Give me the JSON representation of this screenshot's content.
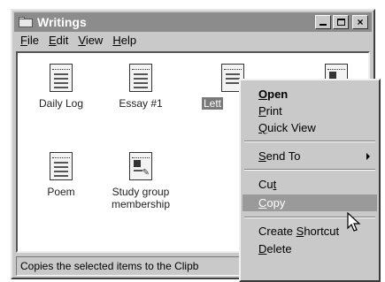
{
  "window": {
    "title": "Writings",
    "buttons": {
      "minimize": "_",
      "maximize": "□",
      "close": "×"
    }
  },
  "menubar": {
    "items": [
      {
        "underline": "F",
        "rest": "ile"
      },
      {
        "underline": "E",
        "rest": "dit"
      },
      {
        "underline": "V",
        "rest": "iew"
      },
      {
        "underline": "H",
        "rest": "elp"
      }
    ]
  },
  "files": [
    {
      "label": "Daily Log",
      "icon": "document-icon"
    },
    {
      "label": "Essay #1",
      "icon": "document-icon"
    },
    {
      "label": "Lett",
      "icon": "document-icon",
      "selected": true
    },
    {
      "label": "",
      "icon": "picture-document-icon"
    },
    {
      "label": "Poem",
      "icon": "document-icon"
    },
    {
      "label": "Study group membership",
      "icon": "picture-document-icon"
    }
  ],
  "status": {
    "text": "Copies the selected items to the Clipb"
  },
  "context_menu": {
    "items": [
      {
        "pre": "",
        "ul": "O",
        "post": "pen"
      },
      {
        "pre": "",
        "ul": "P",
        "post": "rint"
      },
      {
        "pre": "",
        "ul": "Q",
        "post": "uick View"
      },
      {
        "pre": "",
        "ul": "S",
        "post": "end To"
      },
      {
        "pre": "Cu",
        "ul": "t",
        "post": ""
      },
      {
        "pre": "",
        "ul": "C",
        "post": "opy"
      },
      {
        "pre": "Create ",
        "ul": "S",
        "post": "hortcut"
      },
      {
        "pre": "",
        "ul": "D",
        "post": "elete"
      }
    ]
  },
  "colors": {
    "title_bar": "#8c8c8c",
    "highlight": "#9a9a9a",
    "face": "#c9c9c9"
  }
}
